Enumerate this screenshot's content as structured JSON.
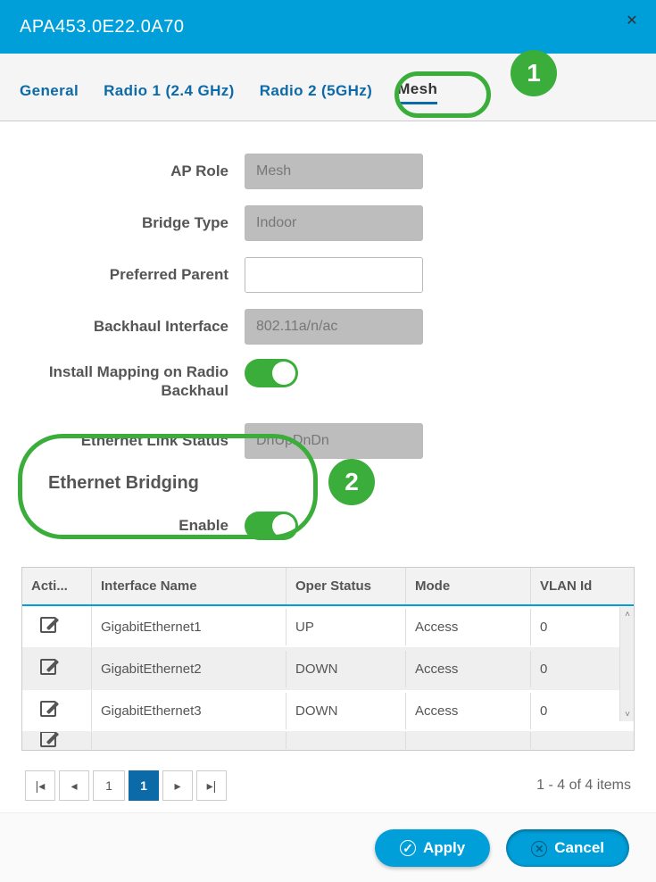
{
  "header": {
    "title": "APA453.0E22.0A70"
  },
  "tabs": {
    "general": "General",
    "radio1": "Radio 1 (2.4 GHz)",
    "radio2": "Radio 2 (5GHz)",
    "mesh": "Mesh"
  },
  "callouts": {
    "one": "1",
    "two": "2"
  },
  "form": {
    "ap_role": {
      "label": "AP Role",
      "value": "Mesh"
    },
    "bridge_type": {
      "label": "Bridge Type",
      "value": "Indoor"
    },
    "preferred_parent": {
      "label": "Preferred Parent",
      "value": ""
    },
    "backhaul_interface": {
      "label": "Backhaul Interface",
      "value": "802.11a/n/ac"
    },
    "install_mapping": {
      "label": "Install Mapping on Radio Backhaul",
      "on": true
    },
    "ethernet_link": {
      "label": "Ethernet Link Status",
      "value": "DnUpDnDn"
    }
  },
  "section": {
    "bridging_title": "Ethernet Bridging",
    "enable_label": "Enable",
    "enable_on": true
  },
  "table": {
    "headers": {
      "action": "Acti...",
      "iface": "Interface Name",
      "oper": "Oper Status",
      "mode": "Mode",
      "vlan": "VLAN Id"
    },
    "rows": [
      {
        "iface": "GigabitEthernet1",
        "oper": "UP",
        "mode": "Access",
        "vlan": "0"
      },
      {
        "iface": "GigabitEthernet2",
        "oper": "DOWN",
        "mode": "Access",
        "vlan": "0"
      },
      {
        "iface": "GigabitEthernet3",
        "oper": "DOWN",
        "mode": "Access",
        "vlan": "0"
      }
    ]
  },
  "pager": {
    "page_input": "1",
    "current_page": "1",
    "info": "1 - 4 of 4 items"
  },
  "footer": {
    "apply": "Apply",
    "cancel": "Cancel"
  }
}
